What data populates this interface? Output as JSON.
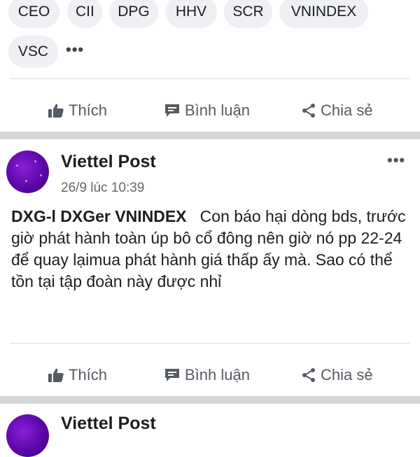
{
  "tags": [
    "CEO",
    "CII",
    "DPG",
    "HHV",
    "SCR",
    "VNINDEX",
    "VSC"
  ],
  "more_label": "•••",
  "actions": {
    "like": "Thích",
    "comment": "Bình luận",
    "share": "Chia sẻ"
  },
  "post": {
    "author": "Viettel Post",
    "time": "26/9 lúc 10:39",
    "tickers": "DXG-l DXGer VNINDEX",
    "text": "Con báo hại dòng bds, trước giờ phát hành toàn úp bô cổ đông nên giờ nó pp 22-24 để quay lạimua phát hành giá thấp ấy mà. Sao có thể tồn tại tập đoàn này được nhỉ",
    "more_label": "•••"
  },
  "next_post": {
    "author": "Viettel Post"
  },
  "colors": {
    "avatar": "#6a0dbf",
    "icon": "#555b63",
    "separator": "#d4d6da"
  }
}
